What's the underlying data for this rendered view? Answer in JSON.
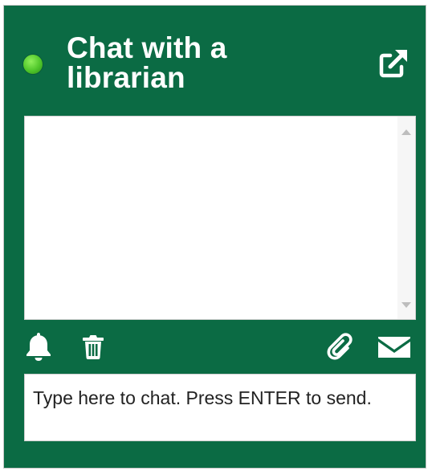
{
  "chat": {
    "title": "Chat with a librarian",
    "status": "online",
    "input": {
      "placeholder": "Type here to chat. Press ENTER to send.",
      "value": ""
    }
  },
  "icons": {
    "status": "online-status-dot",
    "popout": "external-link-icon",
    "notify": "bell-icon",
    "clear": "trash-icon",
    "attach": "paperclip-icon",
    "email": "envelope-icon",
    "scroll_up": "chevron-up-icon",
    "scroll_down": "chevron-down-icon"
  },
  "colors": {
    "panel_background": "#0b6b44",
    "status_online": "#4fc62a",
    "text_light": "#ffffff",
    "input_text": "#222222"
  }
}
